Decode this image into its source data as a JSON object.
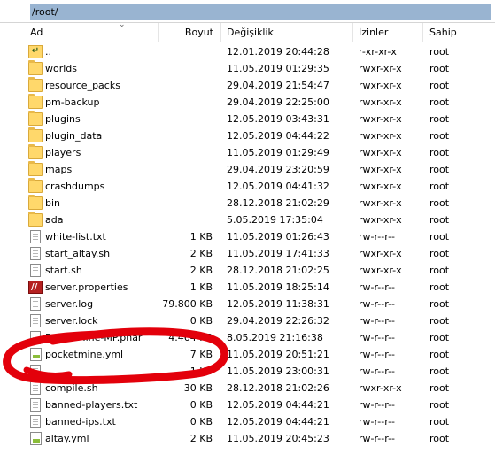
{
  "path": "/root/",
  "columns": {
    "name": "Ad",
    "size": "Boyut",
    "modified": "Değişiklik",
    "permissions": "İzinler",
    "owner": "Sahip"
  },
  "rows": [
    {
      "icon": "parent-folder-icon",
      "name": "..",
      "size": "",
      "date": "12.01.2019 20:44:28",
      "perm": "r-xr-xr-x",
      "owner": "root"
    },
    {
      "icon": "folder-icon",
      "name": "worlds",
      "size": "",
      "date": "11.05.2019 01:29:35",
      "perm": "rwxr-xr-x",
      "owner": "root"
    },
    {
      "icon": "folder-icon",
      "name": "resource_packs",
      "size": "",
      "date": "29.04.2019 21:54:47",
      "perm": "rwxr-xr-x",
      "owner": "root"
    },
    {
      "icon": "folder-icon",
      "name": "pm-backup",
      "size": "",
      "date": "29.04.2019 22:25:00",
      "perm": "rwxr-xr-x",
      "owner": "root"
    },
    {
      "icon": "folder-icon",
      "name": "plugins",
      "size": "",
      "date": "12.05.2019 03:43:31",
      "perm": "rwxr-xr-x",
      "owner": "root"
    },
    {
      "icon": "folder-icon",
      "name": "plugin_data",
      "size": "",
      "date": "12.05.2019 04:44:22",
      "perm": "rwxr-xr-x",
      "owner": "root"
    },
    {
      "icon": "folder-icon",
      "name": "players",
      "size": "",
      "date": "11.05.2019 01:29:49",
      "perm": "rwxr-xr-x",
      "owner": "root"
    },
    {
      "icon": "folder-icon",
      "name": "maps",
      "size": "",
      "date": "29.04.2019 23:20:59",
      "perm": "rwxr-xr-x",
      "owner": "root"
    },
    {
      "icon": "folder-icon",
      "name": "crashdumps",
      "size": "",
      "date": "12.05.2019 04:41:32",
      "perm": "rwxr-xr-x",
      "owner": "root"
    },
    {
      "icon": "folder-icon",
      "name": "bin",
      "size": "",
      "date": "28.12.2018 21:02:29",
      "perm": "rwxr-xr-x",
      "owner": "root"
    },
    {
      "icon": "folder-icon",
      "name": "ada",
      "size": "",
      "date": "5.05.2019 17:35:04",
      "perm": "rwxr-xr-x",
      "owner": "root"
    },
    {
      "icon": "file-icon",
      "name": "white-list.txt",
      "size": "1 KB",
      "date": "11.05.2019 01:26:43",
      "perm": "rw-r--r--",
      "owner": "root"
    },
    {
      "icon": "file-icon",
      "name": "start_altay.sh",
      "size": "2 KB",
      "date": "11.05.2019 17:41:33",
      "perm": "rwxr-xr-x",
      "owner": "root"
    },
    {
      "icon": "file-icon",
      "name": "start.sh",
      "size": "2 KB",
      "date": "28.12.2018 21:02:25",
      "perm": "rwxr-xr-x",
      "owner": "root"
    },
    {
      "icon": "properties-file-icon",
      "name": "server.properties",
      "size": "1 KB",
      "date": "11.05.2019 18:25:14",
      "perm": "rw-r--r--",
      "owner": "root"
    },
    {
      "icon": "file-icon",
      "name": "server.log",
      "size": "79.800 KB",
      "date": "12.05.2019 11:38:31",
      "perm": "rw-r--r--",
      "owner": "root"
    },
    {
      "icon": "file-icon",
      "name": "server.lock",
      "size": "0 KB",
      "date": "29.04.2019 22:26:32",
      "perm": "rw-r--r--",
      "owner": "root"
    },
    {
      "icon": "file-icon",
      "name": "PocketMine-MP.phar",
      "size": "4.464 KB",
      "date": "8.05.2019 21:16:38",
      "perm": "rw-r--r--",
      "owner": "root"
    },
    {
      "icon": "yml-file-icon",
      "name": "pocketmine.yml",
      "size": "7 KB",
      "date": "11.05.2019 20:51:21",
      "perm": "rw-r--r--",
      "owner": "root"
    },
    {
      "icon": "file-icon",
      "name": "",
      "size": "1 KB",
      "date": "11.05.2019 23:00:31",
      "perm": "rw-r--r--",
      "owner": "root"
    },
    {
      "icon": "file-icon",
      "name": "compile.sh",
      "size": "30 KB",
      "date": "28.12.2018 21:02:26",
      "perm": "rwxr-xr-x",
      "owner": "root"
    },
    {
      "icon": "file-icon",
      "name": "banned-players.txt",
      "size": "0 KB",
      "date": "12.05.2019 04:44:21",
      "perm": "rw-r--r--",
      "owner": "root"
    },
    {
      "icon": "file-icon",
      "name": "banned-ips.txt",
      "size": "0 KB",
      "date": "12.05.2019 04:44:21",
      "perm": "rw-r--r--",
      "owner": "root"
    },
    {
      "icon": "yml-file-icon",
      "name": "altay.yml",
      "size": "2 KB",
      "date": "11.05.2019 20:45:23",
      "perm": "rw-r--r--",
      "owner": "root"
    }
  ],
  "annotation": {
    "shape": "red-freehand-circle",
    "color": "#e3000b"
  },
  "colors": {
    "path_highlight": "#99b4d1",
    "folder": "#ffd86b"
  }
}
